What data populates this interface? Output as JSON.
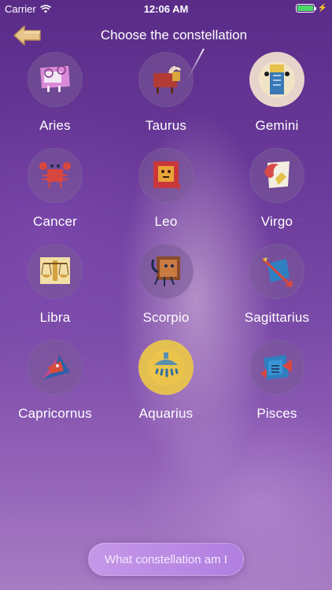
{
  "status_bar": {
    "carrier": "Carrier",
    "time": "12:06 AM"
  },
  "header": {
    "title": "Choose the constellation",
    "back_icon": "back-arrow-icon"
  },
  "signs": [
    {
      "label": "Aries",
      "icon": "aries-icon"
    },
    {
      "label": "Taurus",
      "icon": "taurus-icon"
    },
    {
      "label": "Gemini",
      "icon": "gemini-icon"
    },
    {
      "label": "Cancer",
      "icon": "cancer-icon"
    },
    {
      "label": "Leo",
      "icon": "leo-icon"
    },
    {
      "label": "Virgo",
      "icon": "virgo-icon"
    },
    {
      "label": "Libra",
      "icon": "libra-icon"
    },
    {
      "label": "Scorpio",
      "icon": "scorpio-icon"
    },
    {
      "label": "Sagittarius",
      "icon": "sagittarius-icon"
    },
    {
      "label": "Capricornus",
      "icon": "capricornus-icon"
    },
    {
      "label": "Aquarius",
      "icon": "aquarius-icon"
    },
    {
      "label": "Pisces",
      "icon": "pisces-icon"
    }
  ],
  "bottom_button": {
    "label": "What constellation am I"
  },
  "colors": {
    "background": "#6a3a9a",
    "circle": "#785a96",
    "button": "#c597e8",
    "battery": "#4cd964"
  }
}
